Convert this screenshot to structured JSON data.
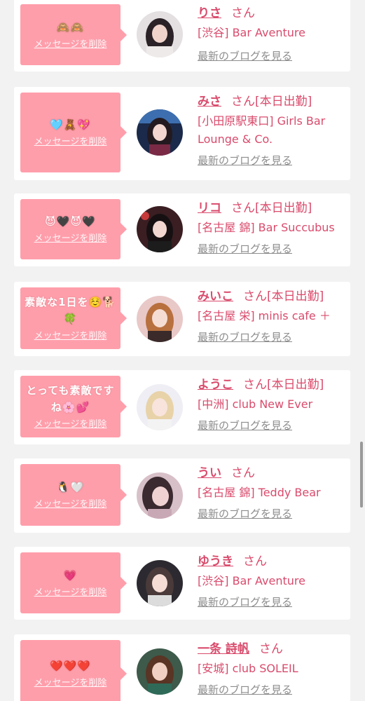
{
  "list_items": [
    {
      "name": "りさ",
      "honorific": "さん",
      "status": "",
      "shop": "[渋谷] Bar Aventure",
      "message": "🙈🙈",
      "delete_label": "メッセージを削除",
      "blog_label": "最新のブログを見る"
    },
    {
      "name": "みさ",
      "honorific": "さん",
      "status": "[本日出勤]",
      "shop": "[小田原駅東口] Girls Bar Lounge & Co.",
      "message": "🩵🧸💖",
      "delete_label": "メッセージを削除",
      "blog_label": "最新のブログを見る"
    },
    {
      "name": "リコ",
      "honorific": "さん",
      "status": "[本日出勤]",
      "shop": "[名古屋 錦] Bar Succubus",
      "message": "😈🖤😈🖤",
      "delete_label": "メッセージを削除",
      "blog_label": "最新のブログを見る"
    },
    {
      "name": "みいこ",
      "honorific": "さん",
      "status": "[本日出勤]",
      "shop": "[名古屋 栄] minis cafe ＋",
      "message": "素敵な1日を☺️🐕🍀",
      "delete_label": "メッセージを削除",
      "blog_label": "最新のブログを見る"
    },
    {
      "name": "ようこ",
      "honorific": "さん",
      "status": "[本日出勤]",
      "shop": "[中洲] club New Ever",
      "message": "とっても素敵ですね🌸💕",
      "delete_label": "メッセージを削除",
      "blog_label": "最新のブログを見る"
    },
    {
      "name": "うい",
      "honorific": "さん",
      "status": "",
      "shop": "[名古屋 錦] Teddy Bear",
      "message": "🐧🤍",
      "delete_label": "メッセージを削除",
      "blog_label": "最新のブログを見る"
    },
    {
      "name": "ゆうき",
      "honorific": "さん",
      "status": "",
      "shop": "[渋谷] Bar Aventure",
      "message": "💗",
      "delete_label": "メッセージを削除",
      "blog_label": "最新のブログを見る"
    },
    {
      "name": "一条 詩帆",
      "honorific": "さん",
      "status": "",
      "shop": "[安城] club SOLEIL",
      "message": "❤️❤️❤️",
      "delete_label": "メッセージを削除",
      "blog_label": "最新のブログを見る"
    }
  ],
  "colors": {
    "bubble": "#ff9eab",
    "accent": "#d94b6c",
    "link_gray": "#8d8d8d",
    "background": "#f2f2f2"
  }
}
